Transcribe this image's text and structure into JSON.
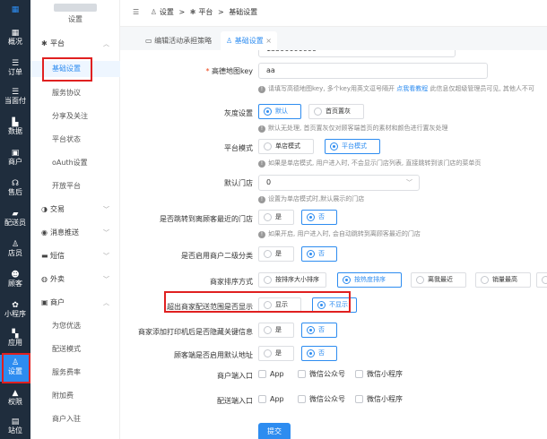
{
  "rail": {
    "items": [
      {
        "label": "概况",
        "icon": "dashboard-icon",
        "glyph": "▦"
      },
      {
        "label": "订单",
        "icon": "order-icon",
        "glyph": "☰"
      },
      {
        "label": "当面付",
        "icon": "pay-icon",
        "glyph": "☰"
      },
      {
        "label": "数据",
        "icon": "chart-icon",
        "glyph": "▙"
      },
      {
        "label": "商户",
        "icon": "shop-icon",
        "glyph": "▣"
      },
      {
        "label": "售后",
        "icon": "headset-icon",
        "glyph": "☊"
      },
      {
        "label": "配送员",
        "icon": "courier-icon",
        "glyph": "▰"
      },
      {
        "label": "店员",
        "icon": "staff-icon",
        "glyph": "♙"
      },
      {
        "label": "顾客",
        "icon": "customer-icon",
        "glyph": "☻"
      },
      {
        "label": "小程序",
        "icon": "miniprogram-icon",
        "glyph": "✿"
      },
      {
        "label": "应用",
        "icon": "apps-icon",
        "glyph": "▚"
      },
      {
        "label": "设置",
        "icon": "settings-icon",
        "glyph": "♙"
      },
      {
        "label": "权限",
        "icon": "lock-icon",
        "glyph": "▲"
      },
      {
        "label": "站位",
        "icon": "doc-icon",
        "glyph": "▤"
      }
    ]
  },
  "sidebar": {
    "title": "设置",
    "groups": [
      {
        "label": "平台",
        "icon": "gear-icon",
        "glyph": "✱",
        "chev": "︿"
      },
      {
        "label": "交易",
        "icon": "trade-icon",
        "glyph": "◑",
        "chev": "﹀"
      },
      {
        "label": "消息推送",
        "icon": "message-icon",
        "glyph": "◉",
        "chev": "﹀"
      },
      {
        "label": "短信",
        "icon": "sms-icon",
        "glyph": "▬",
        "chev": "﹀"
      },
      {
        "label": "外卖",
        "icon": "takeout-icon",
        "glyph": "◍",
        "chev": "﹀"
      },
      {
        "label": "商户",
        "icon": "merchant-icon",
        "glyph": "▣",
        "chev": "︿"
      }
    ],
    "platform_items": [
      "基础设置",
      "服务协议",
      "分享及关注",
      "平台状态",
      "oAuth设置",
      "开放平台"
    ],
    "merchant_items": [
      "为您优选",
      "配送模式",
      "服务费率",
      "附加费",
      "商户入驻"
    ]
  },
  "topbar": {
    "menu_icon": "☰",
    "breadcrumb": [
      "设置",
      ">",
      "平台",
      ">",
      "基础设置"
    ]
  },
  "tabs": [
    {
      "label": "编辑活动承担策略",
      "icon": "▭"
    },
    {
      "label": "基础设置",
      "icon": "♙",
      "close": "×"
    }
  ],
  "form": {
    "phone_value": "13590000000",
    "map_key": {
      "label": "高德地图key",
      "value": "aa",
      "hint": "请填写高德地图key, 多个key用英文逗号隔开",
      "hint_link": "点我看教程",
      "hint_tail": "此信息仅超级管理员可见, 其他人不可"
    },
    "gray": {
      "label": "灰度设置",
      "options": [
        "默认",
        "首页置灰"
      ],
      "selected": 0,
      "hint": "默认无处理, 首页置灰仅对顾客端首页的素材和颜色进行置灰处理"
    },
    "platform_mode": {
      "label": "平台模式",
      "options": [
        "单店模式",
        "平台模式"
      ],
      "selected": 1,
      "hint": "如果是单店模式, 用户进入时, 不会显示门店列表, 直接跳转到该门店的菜单页"
    },
    "default_store": {
      "label": "默认门店",
      "value": "0",
      "hint": "设置为单店模式时,默认展示的门店"
    },
    "jump_nearest": {
      "label": "是否跳转到离顾客最近的门店",
      "options": [
        "是",
        "否"
      ],
      "selected": 1,
      "hint": "如果开启, 用户进入时, 会自动跳转到离顾客最近的门店"
    },
    "second_category": {
      "label": "是否启用商户二级分类",
      "options": [
        "是",
        "否"
      ],
      "selected": 1
    },
    "sort_mode": {
      "label": "商家排序方式",
      "options": [
        "按排序大小排序",
        "按热度排序",
        "离我最近",
        "销量最高",
        "评"
      ],
      "selected": 1
    },
    "out_of_range": {
      "label": "超出商家配送范围是否显示",
      "options": [
        "显示",
        "不显示"
      ],
      "selected": 1
    },
    "printer_hide": {
      "label": "商家添加打印机后是否隐藏关键信息",
      "options": [
        "是",
        "否"
      ],
      "selected": 1
    },
    "default_address": {
      "label": "顾客端是否启用默认地址",
      "options": [
        "是",
        "否"
      ],
      "selected": 1
    },
    "merchant_entry": {
      "label": "商户端入口",
      "options": [
        "App",
        "微信公众号",
        "微信小程序"
      ]
    },
    "courier_entry": {
      "label": "配送端入口",
      "options": [
        "App",
        "微信公众号",
        "微信小程序"
      ]
    },
    "submit": "提交"
  },
  "colors": {
    "rail": "#1f2d3d",
    "accent": "#2d8cf0",
    "highlight": "#e02020"
  }
}
